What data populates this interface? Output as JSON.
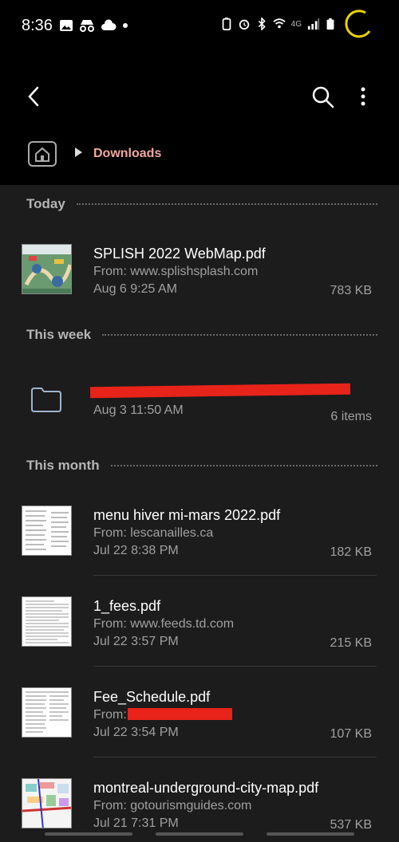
{
  "status_bar": {
    "time": "8:36",
    "network": "4G",
    "left_icons": [
      "image-icon",
      "incognito-icon",
      "cloud-icon",
      "dot-icon"
    ],
    "right_icons": [
      "battery-saver-icon",
      "alarm-icon",
      "bluetooth-icon",
      "wifi-icon",
      "signal-icon",
      "battery-icon"
    ]
  },
  "app_bar": {
    "breadcrumb": "Downloads"
  },
  "sections": {
    "today": "Today",
    "this_week": "This week",
    "this_month": "This month"
  },
  "files": [
    {
      "name": "SPLISH 2022 WebMap.pdf",
      "from": "From: www.splishsplash.com",
      "date": "Aug 6 9:25 AM",
      "size": "783 KB"
    },
    {
      "name": "",
      "date": "Aug 3 11:50 AM",
      "size": "6 items"
    },
    {
      "name": "menu hiver mi-mars 2022.pdf",
      "from": "From: lescanailles.ca",
      "date": "Jul 22 8:38 PM",
      "size": "182 KB"
    },
    {
      "name": "1_fees.pdf",
      "from": "From: www.feeds.td.com",
      "date": "Jul 22 3:57 PM",
      "size": "215 KB"
    },
    {
      "name": "Fee_Schedule.pdf",
      "from": "From:",
      "date": "Jul 22 3:54 PM",
      "size": "107 KB"
    },
    {
      "name": "montreal-underground-city-map.pdf",
      "from": "From: gotourismguides.com",
      "date": "Jul 21 7:31 PM",
      "size": "537 KB"
    }
  ],
  "colors": {
    "background": "#1c1c1c",
    "header_background": "#000000",
    "breadcrumb": "#f0a8a0",
    "redaction": "#e8231a",
    "battery_arc": "#e8d200"
  }
}
